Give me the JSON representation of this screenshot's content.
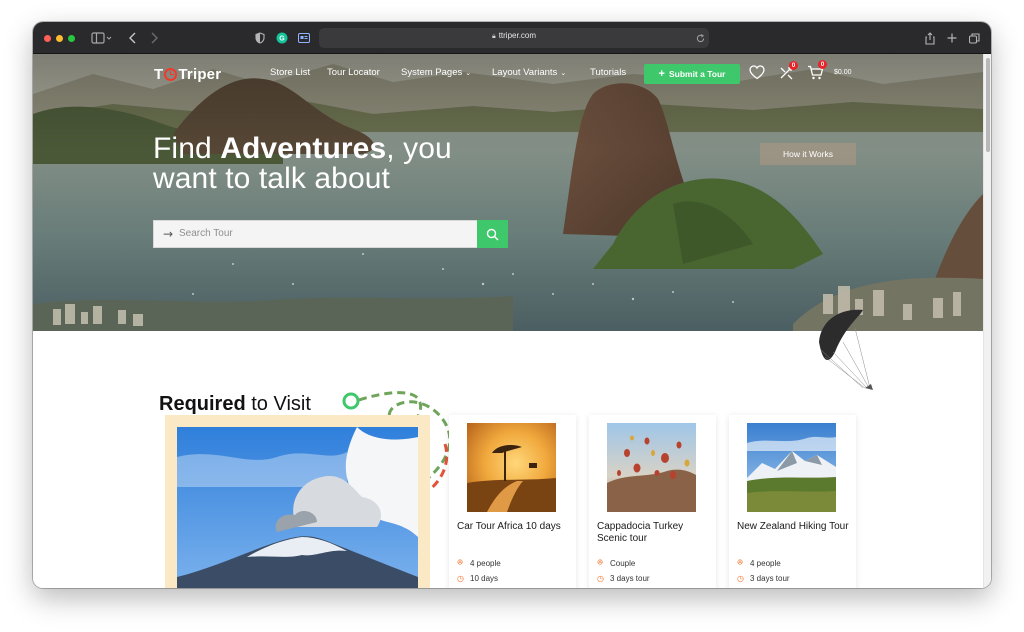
{
  "browser": {
    "url": "ttriper.com"
  },
  "nav": {
    "logo_left": "T",
    "logo_right": "Triper",
    "items": [
      {
        "label": "Store List"
      },
      {
        "label": "Tour Locator"
      },
      {
        "label": "System Pages",
        "dropdown": true
      },
      {
        "label": "Layout Variants",
        "dropdown": true
      },
      {
        "label": "Tutorials"
      }
    ],
    "submit_label": "Submit a Tour",
    "compare_count": "0",
    "cart_count": "0",
    "cart_total": "$0.00"
  },
  "hero": {
    "title_find": "Find ",
    "title_bold": "Adventures",
    "title_rest": ", you",
    "title_line2": "want to talk about",
    "how_label": "How it Works",
    "search_placeholder": "Search Tour"
  },
  "section": {
    "title_bold": "Required",
    "title_rest": " to Visit"
  },
  "tours": [
    {
      "title": "Car Tour Africa 10 days",
      "people": "4 people",
      "duration": "10 days"
    },
    {
      "title": "Cappadocia Turkey Scenic tour",
      "people": "Couple",
      "duration": "3 days tour"
    },
    {
      "title": "New Zealand Hiking Tour",
      "people": "4 people",
      "duration": "3 days tour"
    }
  ],
  "colors": {
    "accent_green": "#3ec86b",
    "badge_red": "#e8242b",
    "meta_orange": "#f2742c",
    "feature_bg": "#fbe8c4"
  }
}
